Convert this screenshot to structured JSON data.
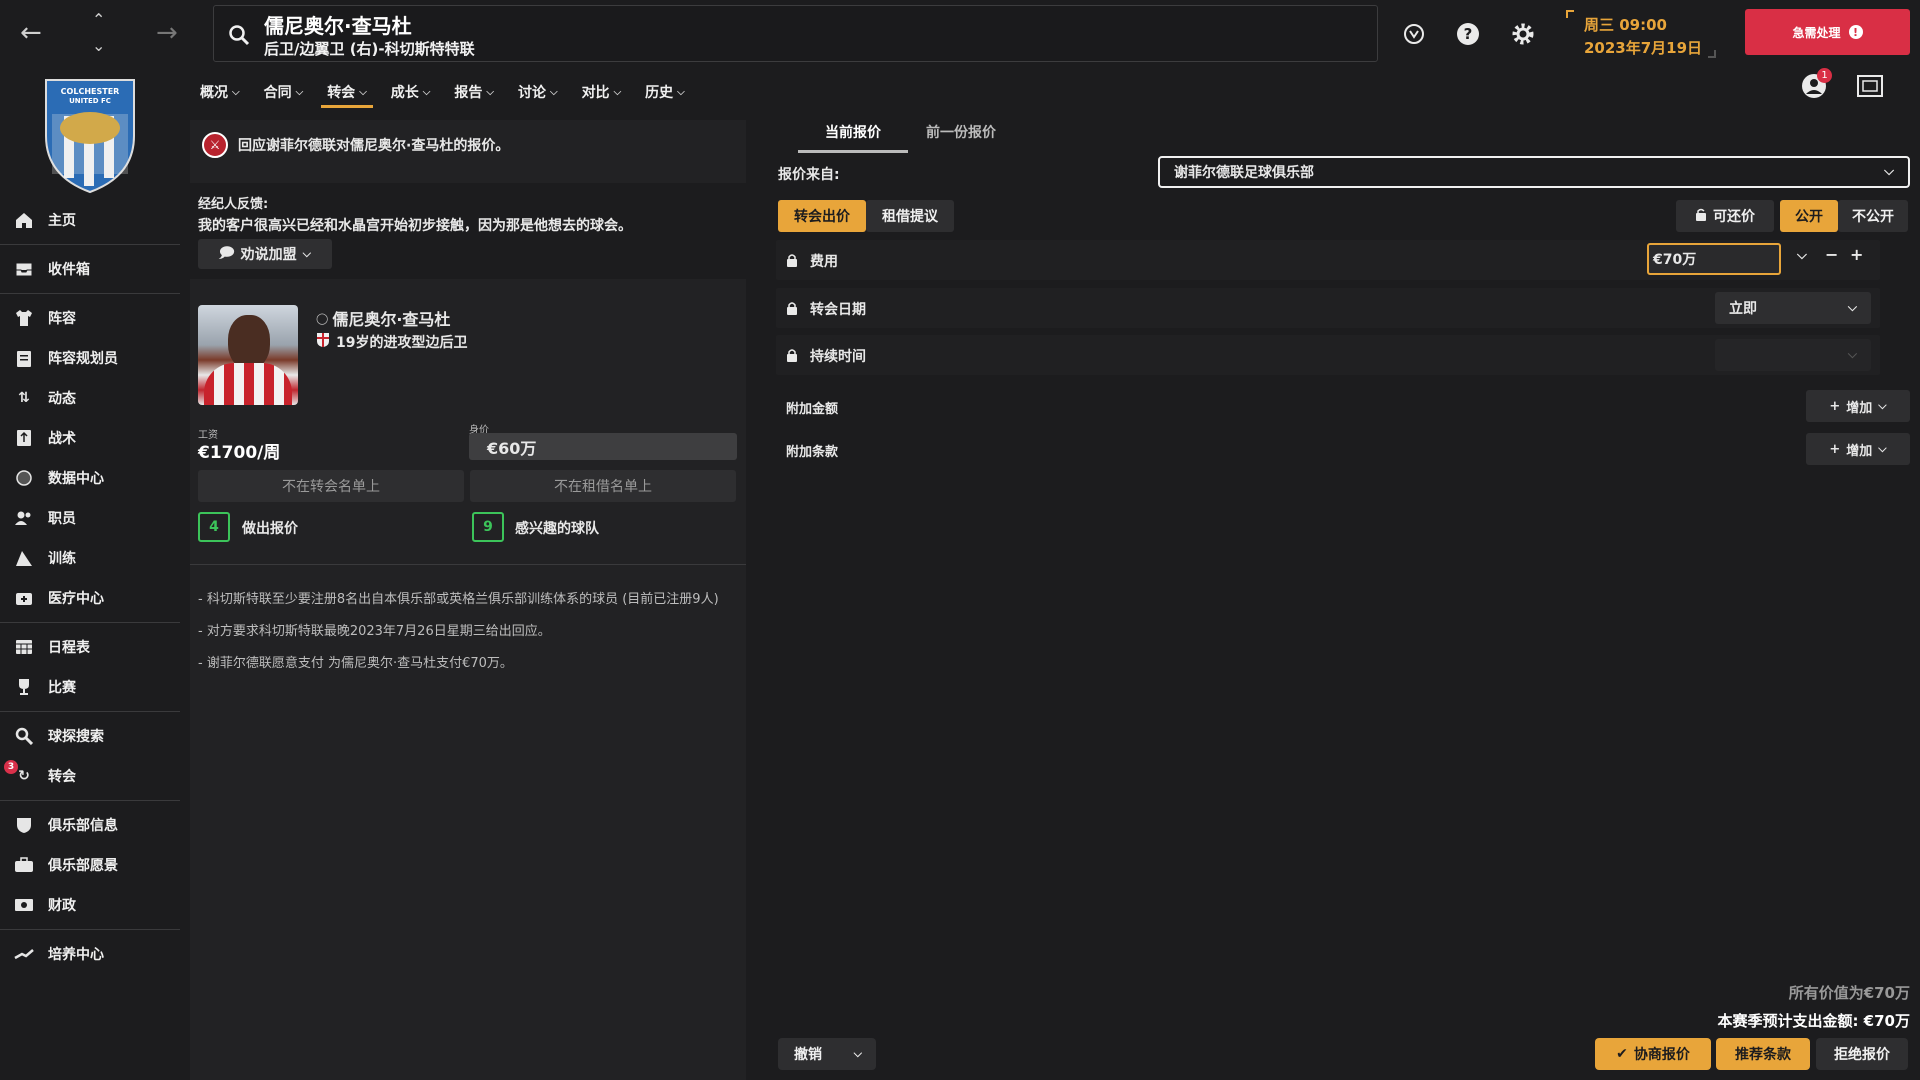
{
  "sidebar": {
    "items": [
      {
        "label": "主页",
        "icon": "home-icon"
      },
      {
        "label": "收件箱",
        "icon": "inbox-icon"
      },
      {
        "label": "阵容",
        "icon": "shirt-icon"
      },
      {
        "label": "阵容规划员",
        "icon": "clipboard-icon"
      },
      {
        "label": "动态",
        "icon": "dynamics-icon"
      },
      {
        "label": "战术",
        "icon": "tactics-icon"
      },
      {
        "label": "数据中心",
        "icon": "data-icon"
      },
      {
        "label": "职员",
        "icon": "staff-icon"
      },
      {
        "label": "训练",
        "icon": "training-icon"
      },
      {
        "label": "医疗中心",
        "icon": "medical-icon"
      },
      {
        "label": "日程表",
        "icon": "calendar-icon"
      },
      {
        "label": "比赛",
        "icon": "trophy-icon"
      },
      {
        "label": "球探搜索",
        "icon": "scout-icon"
      },
      {
        "label": "转会",
        "icon": "transfer-icon",
        "badge": "3"
      },
      {
        "label": "俱乐部信息",
        "icon": "shield-icon"
      },
      {
        "label": "俱乐部愿景",
        "icon": "vision-icon"
      },
      {
        "label": "财政",
        "icon": "finance-icon"
      },
      {
        "label": "培养中心",
        "icon": "development-icon"
      }
    ],
    "crest_text": "COLCHESTER UNITED FC"
  },
  "search": {
    "title": "儒尼奥尔·查马杜",
    "subtitle": "后卫/边翼卫 (右)-科切斯特特联"
  },
  "datetime": {
    "day_time": "周三 09:00",
    "date": "2023年7月19日"
  },
  "urgent": {
    "label": "急需处理"
  },
  "menu": {
    "items": [
      "概况",
      "合同",
      "转会",
      "成长",
      "报告",
      "讨论",
      "对比",
      "历史"
    ],
    "notif_count": "1"
  },
  "left": {
    "banner": "回应谢菲尔德联对儒尼奥尔·查马杜的报价。",
    "agent_title": "经纪人反馈:",
    "agent_text": "我的客户很高兴已经和水晶宫开始初步接触，因为那是他想去的球会。",
    "persuade_label": "劝说加盟",
    "player_name": "儒尼奥尔·查马杜",
    "player_role": "19岁的进攻型边后卫",
    "wage_label": "工资",
    "wage_value": "€1700/周",
    "value_label": "身价",
    "value_value": "€60万",
    "not_transfer_list": "不在转会名单上",
    "not_loan_list": "不在租借名单上",
    "bids_count": "4",
    "bids_label": "做出报价",
    "interested_count": "9",
    "interested_label": "感兴趣的球队",
    "notes": [
      "- 科切斯特联至少要注册8名出自本俱乐部或英格兰俱乐部训练体系的球员 (目前已注册9人)",
      "- 对方要求科切斯特联最晚2023年7月26日星期三给出回应。",
      "- 谢菲尔德联愿意支付 为儒尼奥尔·查马杜支付€70万。"
    ]
  },
  "right": {
    "tab_current": "当前报价",
    "tab_previous": "前一份报价",
    "from_label": "报价来自:",
    "from_value": "谢菲尔德联足球俱乐部",
    "transfer_offer": "转会出价",
    "loan_offer": "租借提议",
    "negotiable": "可还价",
    "public": "公开",
    "private": "不公开",
    "fee_label": "费用",
    "fee_value": "€70万",
    "date_label": "转会日期",
    "date_value": "立即",
    "duration_label": "持续时间",
    "add_money_label": "附加金额",
    "add_clause_label": "附加条款",
    "add_label": "增加",
    "all_value": "所有价值为€70万",
    "season_spend": "本赛季预计支出金额: €70万",
    "cancel": "撤销",
    "negotiate": "协商报价",
    "recommend": "推荐条款",
    "reject": "拒绝报价"
  },
  "colors": {
    "accent": "#e8a53a",
    "urgent": "#d92f45",
    "success": "#3cc45a"
  }
}
